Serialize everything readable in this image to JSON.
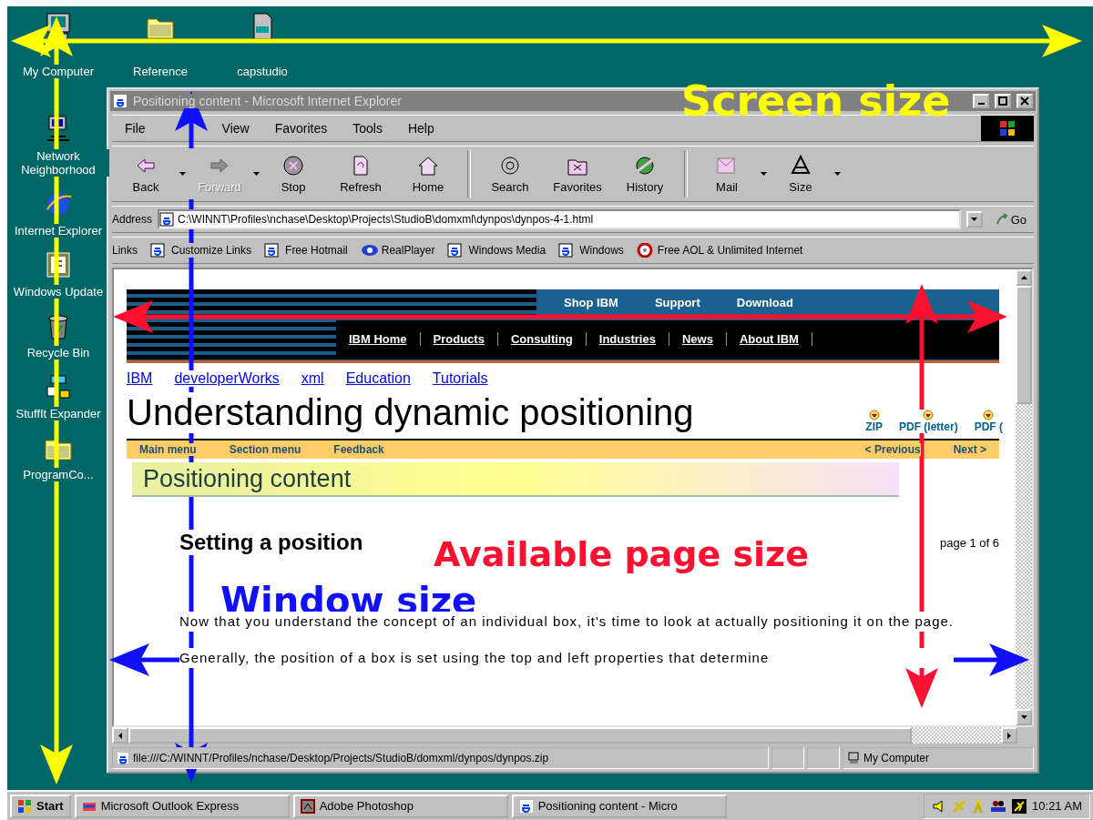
{
  "desktop": {
    "top_icons": [
      {
        "label": "My Computer",
        "kind": "computer"
      },
      {
        "label": "Reference",
        "kind": "folder"
      },
      {
        "label": "capstudio",
        "kind": "file"
      }
    ],
    "side_icons": [
      {
        "label": "Network Neighborhood",
        "kind": "network"
      },
      {
        "label": "Internet Explorer",
        "kind": "ie"
      },
      {
        "label": "Windows Update",
        "kind": "update"
      },
      {
        "label": "Recycle Bin",
        "kind": "bin"
      },
      {
        "label": "StuffIt Expander",
        "kind": "stuffit"
      },
      {
        "label": "ProgramCo...",
        "kind": "folder"
      }
    ]
  },
  "browser": {
    "title": "Positioning content - Microsoft Internet Explorer",
    "menu": [
      "File",
      "View",
      "Favorites",
      "Tools",
      "Help"
    ],
    "toolbar": [
      {
        "label": "Back",
        "kind": "back",
        "disabled": false,
        "dropdown": true
      },
      {
        "label": "Forward",
        "kind": "forward",
        "disabled": true,
        "dropdown": true
      },
      {
        "label": "Stop",
        "kind": "stop",
        "disabled": false,
        "dropdown": false
      },
      {
        "label": "Refresh",
        "kind": "refresh",
        "disabled": false,
        "dropdown": false
      },
      {
        "label": "Home",
        "kind": "home",
        "disabled": false,
        "dropdown": false
      },
      {
        "label": "Search",
        "kind": "search",
        "disabled": false,
        "dropdown": false
      },
      {
        "label": "Favorites",
        "kind": "favorites",
        "disabled": false,
        "dropdown": false
      },
      {
        "label": "History",
        "kind": "history",
        "disabled": false,
        "dropdown": false
      },
      {
        "label": "Mail",
        "kind": "mail",
        "disabled": false,
        "dropdown": true
      },
      {
        "label": "Size",
        "kind": "size",
        "disabled": false,
        "dropdown": true
      }
    ],
    "address": {
      "label": "Address",
      "value": "C:\\WINNT\\Profiles\\nchase\\Desktop\\Projects\\StudioB\\domxml\\dynpos\\dynpos-4-1.html",
      "go": "Go"
    },
    "links": {
      "label": "Links",
      "items": [
        {
          "label": "Customize Links",
          "kind": "ie"
        },
        {
          "label": "Free Hotmail",
          "kind": "ie"
        },
        {
          "label": "RealPlayer",
          "kind": "real"
        },
        {
          "label": "Windows Media",
          "kind": "ie"
        },
        {
          "label": "Windows",
          "kind": "ie"
        },
        {
          "label": "Free AOL & Unlimited Internet",
          "kind": "aol"
        }
      ]
    },
    "page": {
      "banner_links": [
        "Shop IBM",
        "Support",
        "Download"
      ],
      "nav": [
        "IBM Home",
        "Products",
        "Consulting",
        "Industries",
        "News",
        "About IBM"
      ],
      "breadcrumb": [
        "IBM",
        "developerWorks",
        "xml",
        "Education",
        "Tutorials"
      ],
      "title": "Understanding dynamic positioning",
      "downloads": [
        "ZIP",
        "PDF (letter)",
        "PDF ("
      ],
      "menu_left": [
        "Main menu",
        "Section menu",
        "Feedback"
      ],
      "menu_right": [
        "< Previous",
        "Next >"
      ],
      "section": "Positioning content",
      "heading": "Setting a position",
      "page_count": "page 1 of 6",
      "paragraphs": [
        "Now that you understand the concept of an individual box, it's time to look at actually positioning it on the page.",
        "Generally, the position of a box is set using the top and left properties that determine"
      ]
    },
    "status_bar": {
      "text": "file:///C:/WINNT/Profiles/nchase/Desktop/Projects/StudioB/domxml/dynpos/dynpos.zip",
      "zone": "My Computer"
    }
  },
  "taskbar": {
    "start": "Start",
    "tasks": [
      {
        "label": "Microsoft Outlook Express",
        "selected": false
      },
      {
        "label": "Adobe Photoshop",
        "selected": false
      },
      {
        "label": "Positioning content - Micro",
        "selected": false
      }
    ],
    "clock": "10:21 AM"
  },
  "annotations": [
    {
      "label": "Screen size",
      "color": "#ffff00"
    },
    {
      "label": "Available page size",
      "color": "#ff1030"
    },
    {
      "label": "Window size",
      "color": "#1010ff"
    }
  ]
}
